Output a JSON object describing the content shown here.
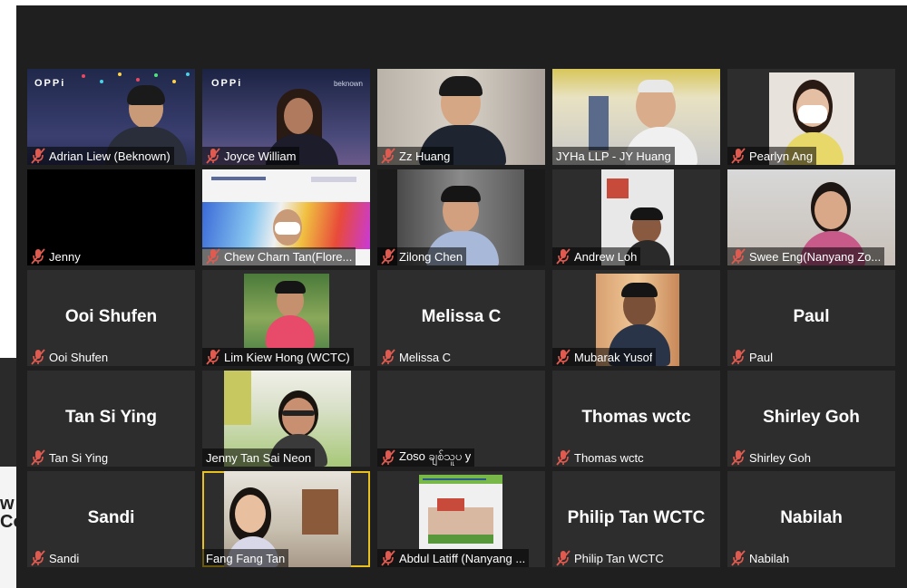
{
  "side": {
    "line1": "w",
    "line2": "Co"
  },
  "colors": {
    "meeting_bg": "#1f1f1f",
    "tile_bg": "#2d2d2d",
    "muted_mic": "#e05a4f"
  },
  "tiles": [
    {
      "label": "Adrian Liew (Beknown)",
      "logo": "OPPi"
    },
    {
      "label": "Joyce William",
      "logo": "OPPi",
      "logo_right": "beknown"
    },
    {
      "label": "Zz Huang"
    },
    {
      "label": "JYHa LLP - JY Huang"
    },
    {
      "label": "Pearlyn Ang"
    },
    {
      "label": "Jenny"
    },
    {
      "label": "Chew Charn Tan(Flore..."
    },
    {
      "label": "Zilong Chen"
    },
    {
      "label": "Andrew Loh"
    },
    {
      "label": "Swee Eng(Nanyang Zo..."
    },
    {
      "label": "Ooi Shufen",
      "big": "Ooi Shufen"
    },
    {
      "label": "Lim Kiew Hong (WCTC)"
    },
    {
      "label": "Melissa C",
      "big": "Melissa C"
    },
    {
      "label": "Mubarak Yusof"
    },
    {
      "label": "Paul",
      "big": "Paul"
    },
    {
      "label": "Tan Si Ying",
      "big": "Tan Si Ying"
    },
    {
      "label": "Jenny Tan Sai Neon"
    },
    {
      "label": "Zoso ချစ်သူပ y"
    },
    {
      "label": "Thomas wctc",
      "big": "Thomas wctc"
    },
    {
      "label": "Shirley Goh",
      "big": "Shirley Goh"
    },
    {
      "label": "Sandi",
      "big": "Sandi"
    },
    {
      "label": "Fang Fang Tan"
    },
    {
      "label": "Abdul Latiff (Nanyang ..."
    },
    {
      "label": "Philip Tan WCTC",
      "big": "Philip Tan WCTC"
    },
    {
      "label": "Nabilah",
      "big": "Nabilah"
    }
  ]
}
